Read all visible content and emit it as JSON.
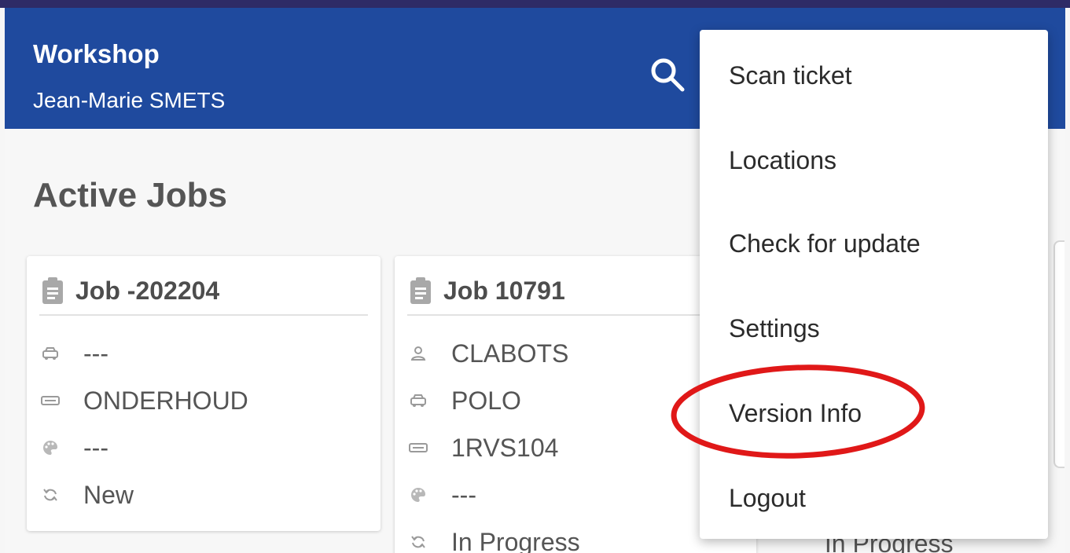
{
  "app_bar": {
    "title": "Workshop",
    "subtitle": "Jean-Marie SMETS",
    "search_icon": "search-icon"
  },
  "main": {
    "section_title": "Active Jobs",
    "cards": [
      {
        "title": "Job -202204",
        "rows": [
          {
            "icon": "car-icon",
            "text": "---"
          },
          {
            "icon": "license-plate-icon",
            "text": "ONDERHOUD"
          },
          {
            "icon": "palette-icon",
            "text": "---"
          },
          {
            "icon": "status-refresh-icon",
            "text": "New"
          }
        ]
      },
      {
        "title": "Job 10791",
        "rows": [
          {
            "icon": "person-icon",
            "text": "CLABOTS"
          },
          {
            "icon": "car-icon",
            "text": "POLO"
          },
          {
            "icon": "license-plate-icon",
            "text": "1RVS104"
          },
          {
            "icon": "palette-icon",
            "text": "---"
          },
          {
            "icon": "status-refresh-icon",
            "text": "In Progress"
          }
        ]
      }
    ],
    "third_card_status": "In Progress"
  },
  "menu": {
    "items": [
      "Scan ticket",
      "Locations",
      "Check for update",
      "Settings",
      "Version Info",
      "Logout"
    ],
    "highlighted_item": "Version Info"
  },
  "colors": {
    "app_bar": "#1f4a9e",
    "status_bar": "#2e2b66",
    "highlight": "#e01818",
    "icon_grey": "#9a9a9a"
  }
}
